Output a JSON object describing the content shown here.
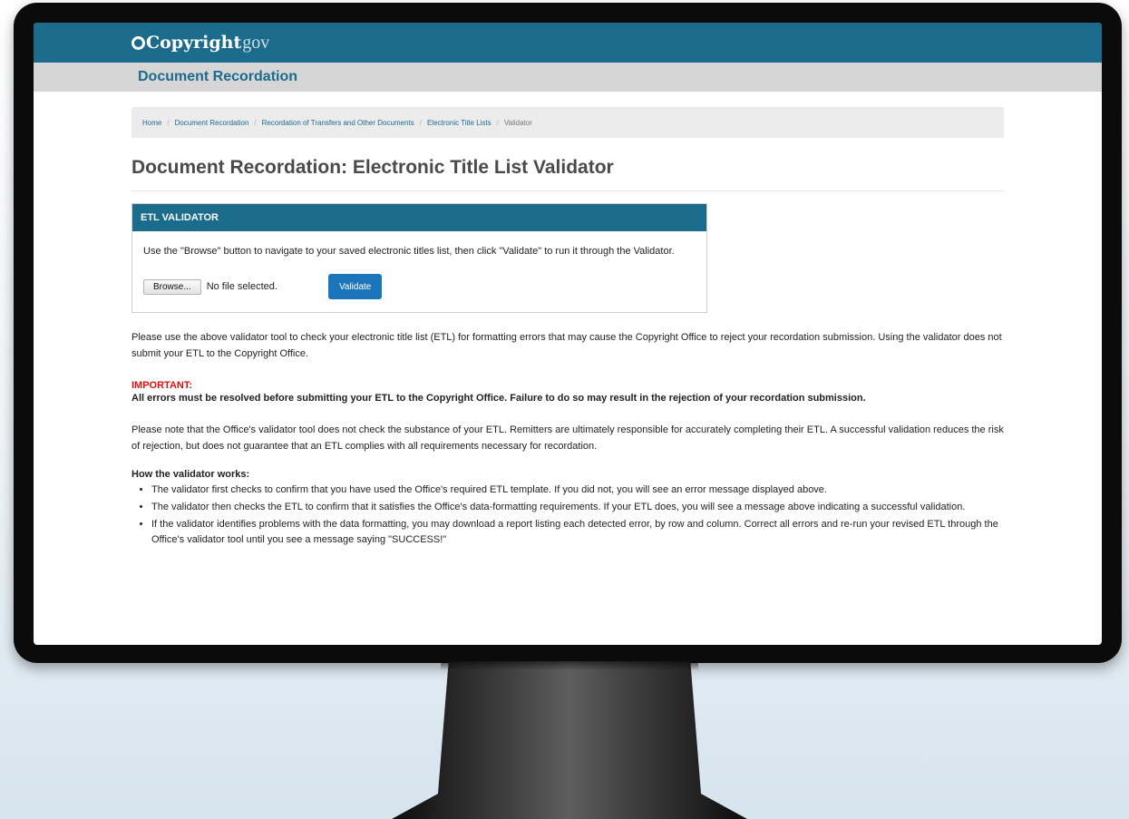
{
  "header": {
    "logo_main": "Copyright",
    "logo_suffix": "gov",
    "section": "Document Recordation"
  },
  "breadcrumb": {
    "items": [
      "Home",
      "Document Recordation",
      "Recordation of Transfers and Other Documents",
      "Electronic Title Lists"
    ],
    "current": "Validator",
    "separator": "/"
  },
  "page": {
    "title": "Document Recordation: Electronic Title List Validator"
  },
  "validator_panel": {
    "heading": "ETL VALIDATOR",
    "instructions": "Use the \"Browse\" button to navigate to your saved electronic titles list, then click \"Validate\" to run it through the Validator.",
    "browse_label": "Browse...",
    "file_status": "No file selected.",
    "validate_label": "Validate"
  },
  "body": {
    "intro": "Please use the above validator tool to check your electronic title list (ETL) for formatting errors that may cause the Copyright Office to reject your recordation submission. Using the validator does not submit your ETL to the Copyright Office.",
    "important_label": "IMPORTANT:",
    "important_text": "All errors must be resolved before submitting your ETL to the Copyright Office. Failure to do so may result in the rejection of your recordation submission.",
    "note": "Please note that the Office's validator tool does not check the substance of your ETL. Remitters are ultimately responsible for accurately completing their ETL. A successful validation reduces the risk of rejection, but does not guarantee that an ETL complies with all requirements necessary for recordation.",
    "how_title": "How the validator works:",
    "how_items": [
      "The validator first checks to confirm that you have used the Office's required ETL template. If you did not, you will see an error message displayed above.",
      "The validator then checks the ETL to confirm that it satisfies the Office's data-formatting requirements. If your ETL does, you will see a message above indicating a successful validation.",
      "If the validator identifies problems with the data formatting, you may download a report listing each detected error, by row and column. Correct all errors and re-run your revised ETL through the Office's validator tool until you see a message saying \"SUCCESS!\""
    ]
  },
  "colors": {
    "brand_blue": "#1b6b8c",
    "button_blue": "#1b75ba",
    "important_red": "#e01010",
    "section_bar_gray": "#d6d6d6"
  }
}
